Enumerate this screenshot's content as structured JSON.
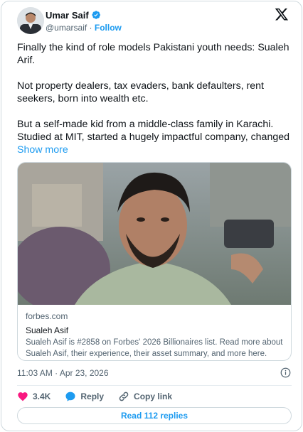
{
  "author": {
    "name": "Umar Saif",
    "handle": "@umarsaif",
    "separator": "·",
    "follow_label": "Follow"
  },
  "tweet": {
    "paragraphs": [
      "Finally the kind of role models Pakistani youth needs: Sualeh Arif.",
      "Not property dealers, tax evaders, bank defaulters, rent seekers, born into wealth etc.",
      "But a self-made kid from a middle-class family in Karachi. Studied at MIT, started a hugely impactful company, changed"
    ],
    "show_more_label": "Show more"
  },
  "link_card": {
    "domain": "forbes.com",
    "title": "Sualeh Asif",
    "description": "Sualeh Asif is #2858 on Forbes' 2026 Billionaires list. Read more about Sualeh Asif, their experience, their asset summary, and more here."
  },
  "timestamp": "11:03 AM · Apr 23, 2026",
  "actions": {
    "like_count": "3.4K",
    "reply_label": "Reply",
    "copy_link_label": "Copy link"
  },
  "read_replies_label": "Read 112 replies",
  "colors": {
    "accent": "#1d9bf0",
    "like": "#f91880",
    "text": "#0f1419",
    "secondary": "#536471",
    "border": "#cfd9de"
  },
  "icons": [
    "verified-badge-icon",
    "x-logo-icon",
    "info-icon",
    "heart-icon",
    "reply-bubble-icon",
    "link-icon"
  ]
}
